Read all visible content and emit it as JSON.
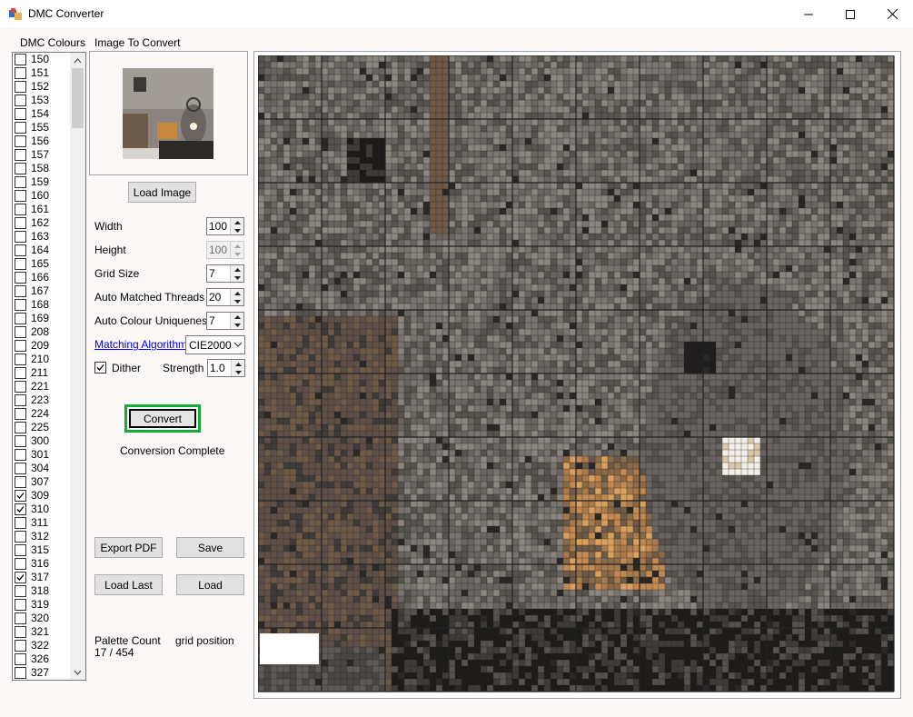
{
  "window": {
    "title": "DMC Converter",
    "minimize_glyph": "—",
    "maximize_glyph": "☐",
    "close_glyph": "✕"
  },
  "labels": {
    "dmc_colours": "DMC Colours",
    "image_to_convert": "Image To Convert"
  },
  "colour_list": {
    "items": [
      {
        "label": "150",
        "checked": false
      },
      {
        "label": "151",
        "checked": false
      },
      {
        "label": "152",
        "checked": false
      },
      {
        "label": "153",
        "checked": false
      },
      {
        "label": "154",
        "checked": false
      },
      {
        "label": "155",
        "checked": false
      },
      {
        "label": "156",
        "checked": false
      },
      {
        "label": "157",
        "checked": false
      },
      {
        "label": "158",
        "checked": false
      },
      {
        "label": "159",
        "checked": false
      },
      {
        "label": "160",
        "checked": false
      },
      {
        "label": "161",
        "checked": false
      },
      {
        "label": "162",
        "checked": false
      },
      {
        "label": "163",
        "checked": false
      },
      {
        "label": "164",
        "checked": false
      },
      {
        "label": "165",
        "checked": false
      },
      {
        "label": "166",
        "checked": false
      },
      {
        "label": "167",
        "checked": false
      },
      {
        "label": "168",
        "checked": false
      },
      {
        "label": "169",
        "checked": false
      },
      {
        "label": "208",
        "checked": false
      },
      {
        "label": "209",
        "checked": false
      },
      {
        "label": "210",
        "checked": false
      },
      {
        "label": "211",
        "checked": false
      },
      {
        "label": "221",
        "checked": false
      },
      {
        "label": "223",
        "checked": false
      },
      {
        "label": "224",
        "checked": false
      },
      {
        "label": "225",
        "checked": false
      },
      {
        "label": "300",
        "checked": false
      },
      {
        "label": "301",
        "checked": false
      },
      {
        "label": "304",
        "checked": false
      },
      {
        "label": "307",
        "checked": false
      },
      {
        "label": "309",
        "checked": true
      },
      {
        "label": "310",
        "checked": true
      },
      {
        "label": "311",
        "checked": false
      },
      {
        "label": "312",
        "checked": false
      },
      {
        "label": "315",
        "checked": false
      },
      {
        "label": "316",
        "checked": false
      },
      {
        "label": "317",
        "checked": true
      },
      {
        "label": "318",
        "checked": false
      },
      {
        "label": "319",
        "checked": false
      },
      {
        "label": "320",
        "checked": false
      },
      {
        "label": "321",
        "checked": false
      },
      {
        "label": "322",
        "checked": false
      },
      {
        "label": "326",
        "checked": false
      },
      {
        "label": "327",
        "checked": false
      }
    ]
  },
  "buttons": {
    "load_image": "Load Image",
    "convert": "Convert",
    "export_pdf": "Export PDF",
    "save": "Save",
    "load_last": "Load Last",
    "load": "Load"
  },
  "settings": {
    "width": {
      "label": "Width",
      "value": "100"
    },
    "height": {
      "label": "Height",
      "value": "100"
    },
    "grid_size": {
      "label": "Grid Size",
      "value": "7"
    },
    "auto_matched_threads": {
      "label": "Auto Matched Threads",
      "value": "20"
    },
    "auto_colour_uniqueness": {
      "label": "Auto Colour Uniqueness",
      "value": "7"
    },
    "matching_algorithm": {
      "label": "Matching Algorithm",
      "value": "CIE2000"
    },
    "dither": {
      "label": "Dither",
      "checked": true
    },
    "strength": {
      "label": "Strength",
      "value": "1.0"
    }
  },
  "status": {
    "conversion": "Conversion Complete",
    "palette_count_label": "Palette Count",
    "palette_count_value": "17 / 454",
    "grid_position_label": "grid position"
  },
  "colors": {
    "convert_highlight": "#15a83a",
    "link": "#0000ff",
    "palette": [
      "#7a7570",
      "#6a6560",
      "#56524e",
      "#8c8680",
      "#3e3b39",
      "#4a4644",
      "#9a948d",
      "#2a2827",
      "#5e5a56",
      "#b2aaa1"
    ],
    "warm": [
      "#8a6a48",
      "#a87a4c",
      "#c48a52",
      "#6e5a46",
      "#d9a05e"
    ],
    "glow": "#f4efe6"
  }
}
